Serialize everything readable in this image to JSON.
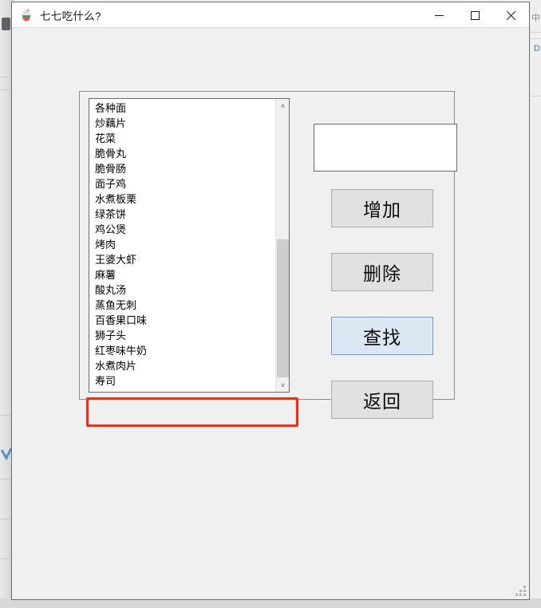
{
  "window": {
    "title": "七七吃什么?",
    "app_icon": "ramen-bowl-icon",
    "controls": {
      "minimize_label": "—",
      "maximize_label": "□",
      "close_label": "✕"
    }
  },
  "listbox": {
    "name": "food-list",
    "items": [
      "各种面",
      "炒藕片",
      "花菜",
      "脆骨丸",
      "脆骨肠",
      "面子鸡",
      "水煮板栗",
      "绿茶饼",
      "鸡公煲",
      "烤肉",
      "王婆大虾",
      "麻薯",
      "酸丸汤",
      "蒸鱼无刺",
      "百香果口味",
      "狮子头",
      "红枣味牛奶",
      "水煮肉片",
      "寿司"
    ],
    "highlighted_item": "寿司",
    "scrollbar": {
      "up_arrow": "˄",
      "down_arrow": "˅"
    }
  },
  "input": {
    "value": "",
    "placeholder": ""
  },
  "buttons": [
    {
      "label": "增加",
      "state": "normal"
    },
    {
      "label": "删除",
      "state": "normal"
    },
    {
      "label": "查找",
      "state": "focused"
    },
    {
      "label": "返回",
      "state": "normal"
    }
  ],
  "annotation": {
    "color": "#fc2a14",
    "target": "寿司"
  },
  "colors": {
    "window_bg": "#f0f0f0",
    "titlebar_bg": "#ffffff",
    "button_bg": "#e1e1e1",
    "button_focus_bg": "#dce7f3",
    "button_focus_border": "#6f9dc9",
    "list_bg": "#ffffff",
    "scroll_thumb": "#cdcdcd",
    "annotation": "#fc2a14"
  }
}
